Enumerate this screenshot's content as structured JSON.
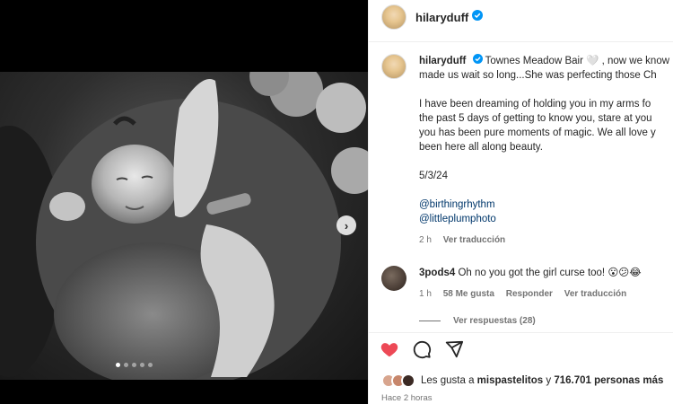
{
  "post": {
    "username": "hilaryduff",
    "carousel": {
      "total_slides": 5,
      "active_index": 0
    }
  },
  "caption": {
    "username": "hilaryduff",
    "line1": "Townes Meadow Bair 🤍 , now we know",
    "line2": "made us wait so long...She was perfecting those Ch",
    "para2_l1": "I have been dreaming of holding you in my arms fo",
    "para2_l2": "the past 5 days of getting to know you, stare at you",
    "para2_l3": "you has been pure moments of magic. We all love y",
    "para2_l4": "been here all along beauty.",
    "date": "5/3/24",
    "mention1": "@birthingrhythm",
    "mention2": "@littleplumphoto",
    "time": "2 h",
    "see_translation": "Ver traducción"
  },
  "comment": {
    "username": "3pods4",
    "text": "Oh no you got the girl curse too! 😮😕😂",
    "time": "1 h",
    "likes": "58 Me gusta",
    "reply": "Responder",
    "see_translation": "Ver traducción",
    "view_replies": "Ver respuestas (28)"
  },
  "likes": {
    "prefix": "Les gusta a",
    "user": "mispastelitos",
    "connector": "y",
    "count": "716.701 personas más"
  },
  "posted_ago": "Hace 2 horas",
  "colors": {
    "like_red": "#ed4956",
    "verified_blue": "#0095f6",
    "link_blue": "#00376b"
  }
}
